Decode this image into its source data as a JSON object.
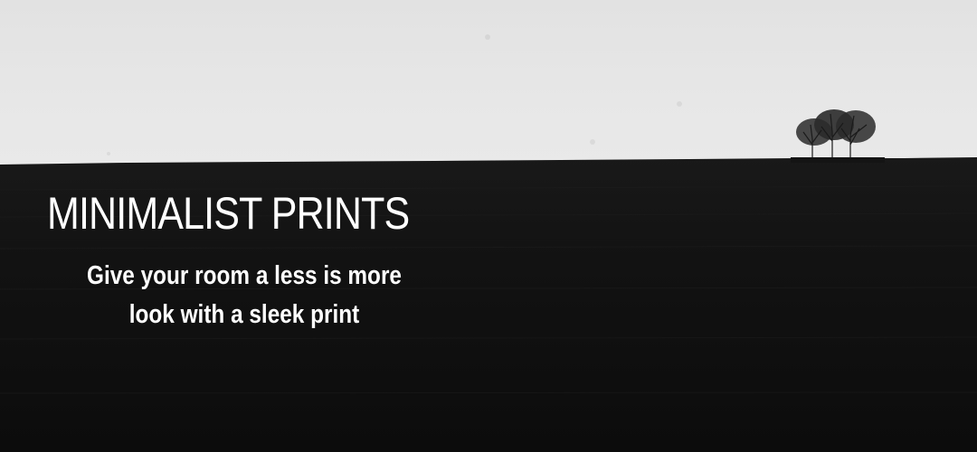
{
  "banner": {
    "headline": "MINIMALIST PRINTS",
    "subtext": {
      "line1": "Give your room a less is more",
      "line2": "look with a sleek print"
    }
  },
  "scene": {
    "sky_color": "#e5e5e5",
    "field_color": "#111111",
    "text_color": "#ffffff",
    "illustration": "tree-cluster-icon"
  }
}
